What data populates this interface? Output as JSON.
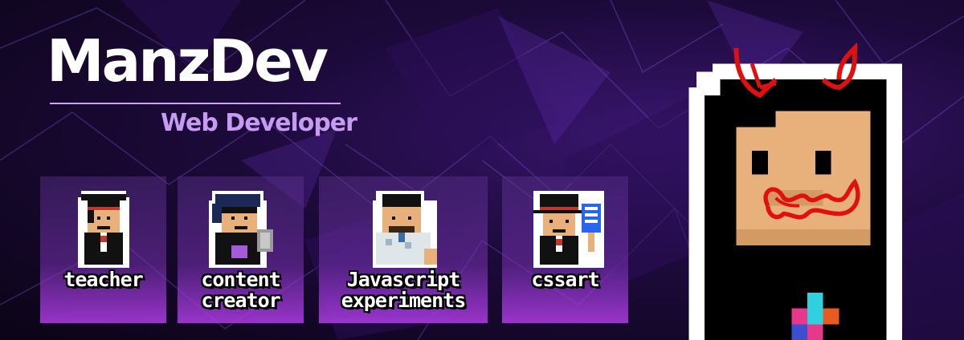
{
  "brand": {
    "title": "ManzDev",
    "subtitle": "Web Developer"
  },
  "roles": [
    {
      "label": "teacher",
      "avatar": "teacher-avatar-icon"
    },
    {
      "label": "content creator",
      "avatar": "content-creator-avatar-icon"
    },
    {
      "label": "Javascript experiments",
      "avatar": "javascript-avatar-icon"
    },
    {
      "label": "cssart",
      "avatar": "cssart-avatar-icon"
    }
  ],
  "colors": {
    "accent": "#c69cf2",
    "card_bottom": "#af3ce6",
    "horns": "#e01010",
    "skin": "#e8b07a"
  }
}
